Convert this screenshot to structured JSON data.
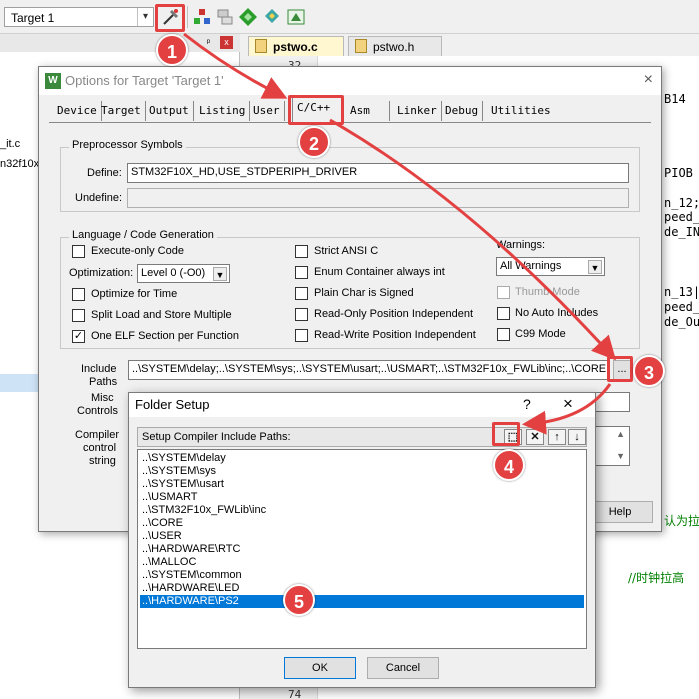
{
  "toolbar": {
    "target": "Target 1",
    "target_arrow": "▾",
    "icons": [
      "options-for-target-icon",
      "manage-project-items-icon",
      "select-packs-icon",
      "manage-components-icon",
      "dual-diamond-icon",
      "pack-installer-icon"
    ]
  },
  "left_panel": {
    "items": [
      "_it.c",
      "n32f10x"
    ],
    "pin": "ᵖ",
    "close": "x"
  },
  "editor": {
    "tabs": [
      "pstwo.c",
      "pstwo.h"
    ],
    "gutter_top_line": "32",
    "gutter_bottom_line": "74",
    "code_fragments": [
      "B14",
      "PIOB",
      "n_12;",
      "peed_",
      "de_IN",
      "n_13|",
      "peed_",
      "de_Ou"
    ],
    "comments": [
      "认为拉",
      "//时钟拉高"
    ]
  },
  "options_dialog": {
    "title": "Options for Target 'Target 1'",
    "close": "×",
    "tabs": [
      "Device",
      "Target",
      "Output",
      "Listing",
      "User",
      "C/C++",
      "Asm",
      "Linker",
      "Debug",
      "Utilities"
    ],
    "active_tab": "C/C++",
    "preprocessor": {
      "title": "Preprocessor Symbols",
      "define_label": "Define:",
      "define_value": "STM32F10X_HD,USE_STDPERIPH_DRIVER",
      "undefine_label": "Undefine:",
      "undefine_value": ""
    },
    "language": {
      "title": "Language / Code Generation",
      "execute_only": "Execute-only Code",
      "optimization_label": "Optimization:",
      "optimization_value": "Level 0 (-O0)",
      "optimize_time": "Optimize for Time",
      "split_load": "Split Load and Store Multiple",
      "one_elf": "One ELF Section per Function",
      "strict_ansi": "Strict ANSI C",
      "enum_container": "Enum Container always int",
      "plain_char": "Plain Char is Signed",
      "ro_pos": "Read-Only Position Independent",
      "rw_pos": "Read-Write Position Independent",
      "warnings_label": "Warnings:",
      "warnings_value": "All Warnings",
      "thumb_mode": "Thumb Mode",
      "no_auto_includes": "No Auto Includes",
      "c99_mode": "C99 Mode",
      "checked": {
        "execute_only": false,
        "optimize_time": false,
        "split_load": false,
        "one_elf": true,
        "strict_ansi": false,
        "enum_container": false,
        "plain_char": false,
        "ro_pos": false,
        "rw_pos": false,
        "thumb_mode": false,
        "no_auto_includes": false,
        "c99_mode": false
      }
    },
    "include_paths_label_1": "Include",
    "include_paths_label_2": "Paths",
    "include_paths_value": "..\\SYSTEM\\delay;..\\SYSTEM\\sys;..\\SYSTEM\\usart;..\\USMART;..\\STM32F10x_FWLib\\inc;..\\CORE",
    "browse": "...",
    "misc_label_1": "Misc",
    "misc_label_2": "Controls",
    "compiler_label_1": "Compiler",
    "compiler_label_2": "control",
    "compiler_label_3": "string",
    "help": "Help"
  },
  "folder_dialog": {
    "title": "Folder Setup",
    "help": "?",
    "close": "×",
    "header": "Setup Compiler Include Paths:",
    "header_buttons": [
      "⬚",
      "✕",
      "↑",
      "↓"
    ],
    "paths": [
      "..\\SYSTEM\\delay",
      "..\\SYSTEM\\sys",
      "..\\SYSTEM\\usart",
      "..\\USMART",
      "..\\STM32F10x_FWLib\\inc",
      "..\\CORE",
      "..\\USER",
      "..\\HARDWARE\\RTC",
      "..\\MALLOC",
      "..\\SYSTEM\\common",
      "..\\HARDWARE\\LED",
      "..\\HARDWARE\\PS2"
    ],
    "selected_index": 11,
    "ok": "OK",
    "cancel": "Cancel"
  },
  "annotations": [
    "1",
    "2",
    "3",
    "4",
    "5"
  ],
  "colors": {
    "annotation": "#e34141",
    "selection": "#0078d7",
    "comment": "#008000"
  }
}
